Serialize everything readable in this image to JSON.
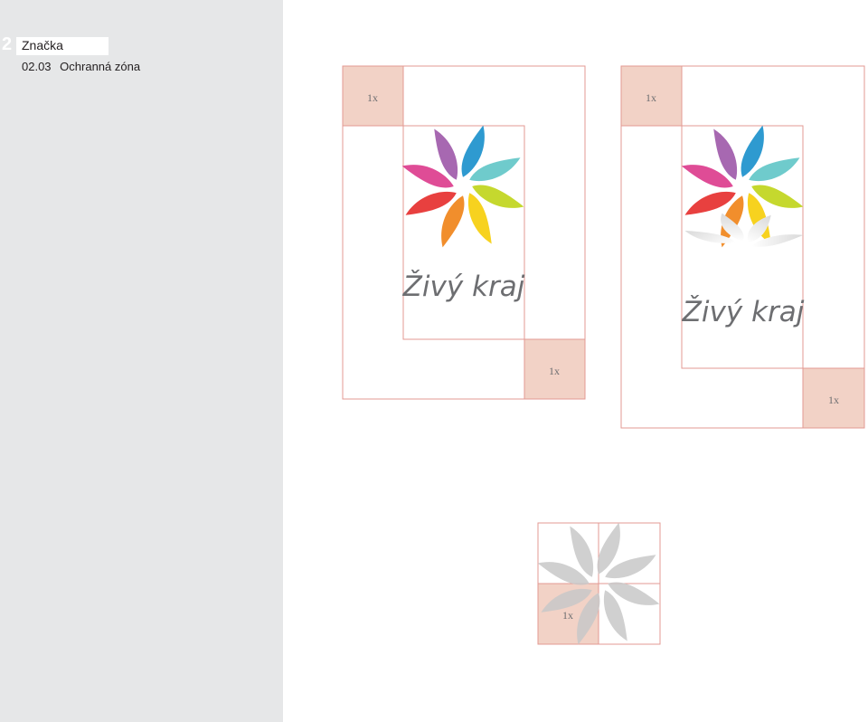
{
  "header": {
    "chapter_number": "2",
    "chapter_title": "Značka",
    "section_code": "02.03",
    "section_title": "Ochranná zóna"
  },
  "zone_label": "1x",
  "wordmark": "Živý kraj",
  "colors": {
    "sidebar": "#e6e7e8",
    "zone_fill": "#f2d2c6",
    "guide_line": "#e39a93",
    "petals": [
      "#2e9ad0",
      "#6fcbcc",
      "#c5d82e",
      "#f7d21f",
      "#f18e2c",
      "#e8403f",
      "#df4c96",
      "#a768b1"
    ],
    "monochrome": "#c8c8c8"
  },
  "icons": [
    "flower-logo-icon",
    "flower-logo-grey-icon"
  ]
}
